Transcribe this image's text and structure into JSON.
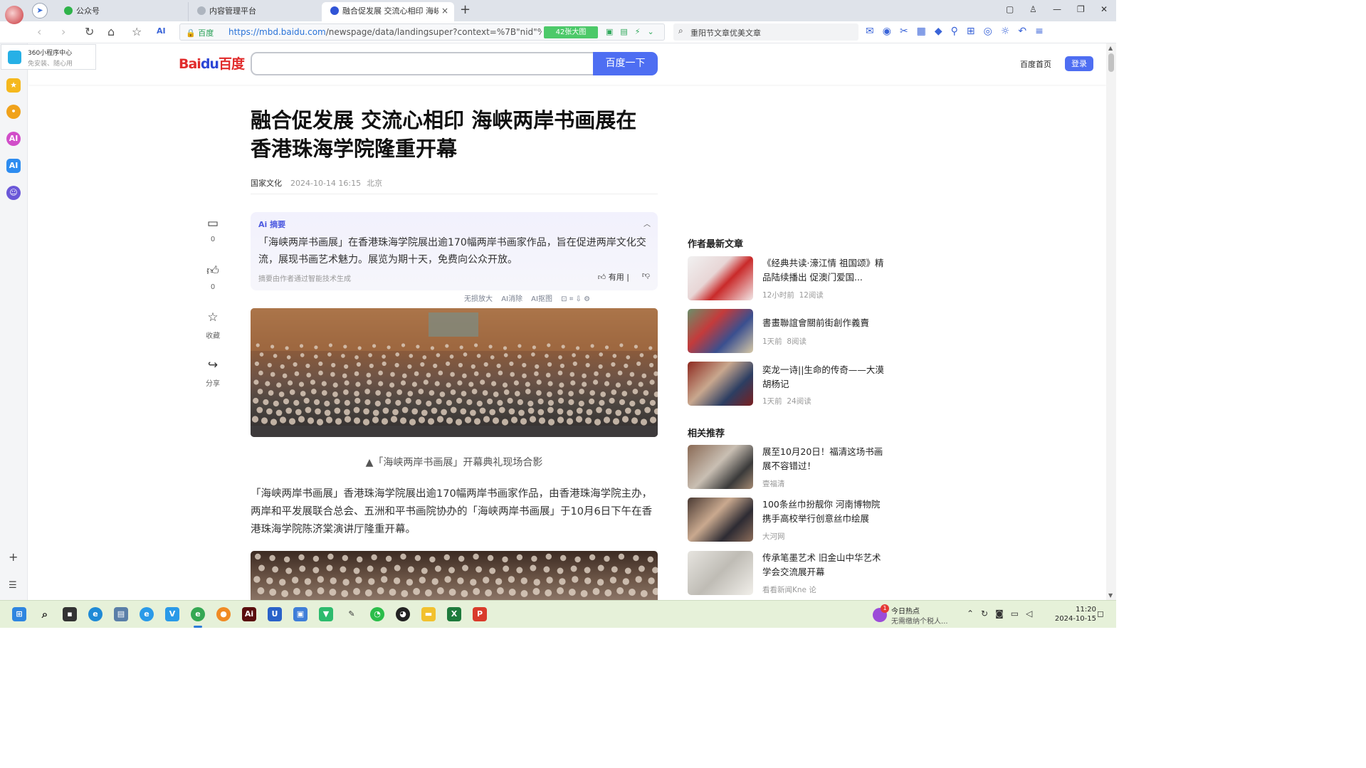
{
  "browser": {
    "tabs": [
      {
        "title": "公众号"
      },
      {
        "title": "内容管理平台"
      },
      {
        "title": "融合促发展 交流心相印 海峡两岸",
        "close": "×"
      }
    ],
    "new_tab": "+",
    "window_buttons": {
      "minimize": "—",
      "restore": "❐",
      "close": "✕"
    },
    "url": {
      "label": "百度",
      "host": "https://mbd.baidu.com",
      "path": "/newspage/data/landingsuper?context=%7B\"nid\"%3A\"ne"
    },
    "bigimg_badge": "42张大图",
    "search": {
      "text": "重阳节文章优美文章"
    }
  },
  "sidebar": {
    "popup": {
      "title": "360小程序中心",
      "subtitle": "免安装、随心用"
    }
  },
  "header": {
    "logo": {
      "bai": "Bai",
      "du": "du",
      "cn": "百度"
    },
    "search_button": "百度一下",
    "home_link": "百度首页",
    "login": "登录"
  },
  "article": {
    "title": "融合促发展 交流心相印 海峡两岸书画展在香港珠海学院隆重开幕",
    "source": "国家文化",
    "datetime": "2024-10-14 16:15",
    "location": "北京",
    "actions": {
      "comment_count": "0",
      "like_count": "0",
      "favorite": "收藏",
      "share": "分享"
    },
    "ai_summary": {
      "label": "摘要",
      "text": "「海峡两岸书画展」在香港珠海学院展出逾170幅两岸书画家作品，旨在促进两岸文化交流，展现书画艺术魅力。展览为期十天，免费向公众开放。",
      "footnote": "摘要由作者通过智能技术生成",
      "useful": "有用"
    },
    "image_tools": [
      "无损放大",
      "AI消除",
      "AI抠图"
    ],
    "caption": "▲「海峡两岸书画展」开幕典礼现场合影",
    "paragraph": "「海峡两岸书画展」香港珠海学院展出逾170幅两岸书画家作品，由香港珠海学院主办，两岸和平发展联合总会、五洲和平书画院协办的「海峡两岸书画展」于10月6日下午在香港珠海学院陈济棠演讲厅隆重开幕。"
  },
  "right": {
    "latest_title": "作者最新文章",
    "latest": [
      {
        "title": "《经典共读·濠江情 祖国颂》精品陆续播出 促澳门爱国...",
        "time": "12小时前",
        "reads": "12阅读"
      },
      {
        "title": "書畫聯誼會關前街創作義賣",
        "time": "1天前",
        "reads": "8阅读"
      },
      {
        "title": "奕龙一诗||生命的传奇——大漠胡杨记",
        "time": "1天前",
        "reads": "24阅读"
      }
    ],
    "related_title": "相关推荐",
    "related": [
      {
        "title": "展至10月20日！福清这场书画展不容错过！",
        "source": "壹福清"
      },
      {
        "title": "100条丝巾扮靓你 河南博物院携手高校举行创意丝巾绘展",
        "source": "大河网"
      },
      {
        "title": "传承笔墨艺术 旧金山中华艺术学会交流展开幕",
        "source": "看看新闻Kne  论"
      }
    ]
  },
  "taskbar": {
    "news_badge": "1",
    "news_title": "今日热点",
    "news_sub": "无需缴纳个税人...",
    "time": "11:20",
    "date": "2024-10-15"
  },
  "colors": {
    "baidu_blue": "#4e6ef2",
    "baidu_red": "#e12c2c",
    "taskbar": "#e6f1d9"
  }
}
